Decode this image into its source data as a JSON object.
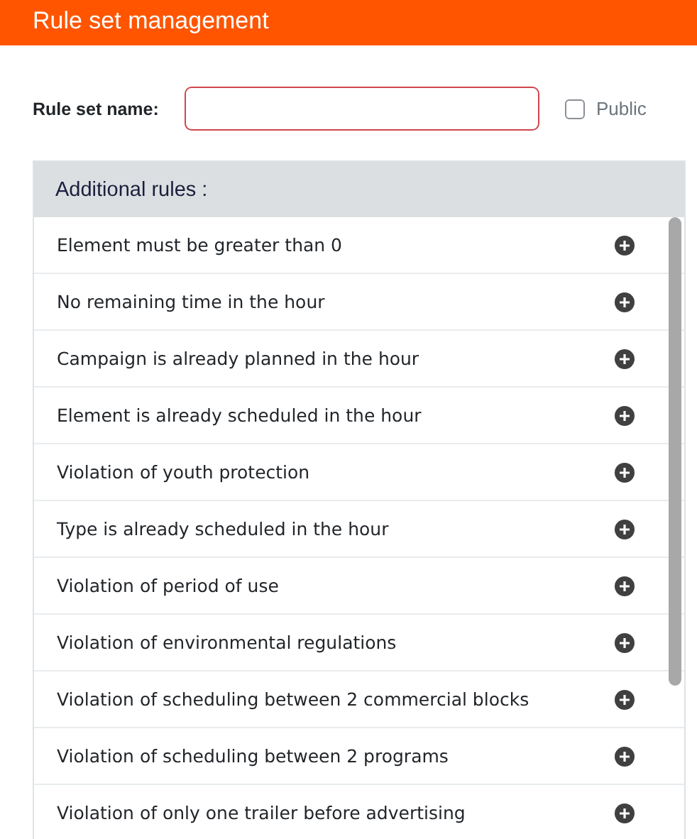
{
  "window": {
    "title": "Rule set management"
  },
  "form": {
    "name_label": "Rule set name:",
    "public": {
      "label": "Public",
      "checked": false
    }
  },
  "rules_panel": {
    "title": "Additional rules :",
    "rules": [
      {
        "label": "Element must be greater than 0"
      },
      {
        "label": "No remaining time in the hour"
      },
      {
        "label": "Campaign is already planned in the hour"
      },
      {
        "label": "Element is already scheduled in the hour"
      },
      {
        "label": "Violation of youth protection"
      },
      {
        "label": "Type is already scheduled in the hour"
      },
      {
        "label": "Violation of period of use"
      },
      {
        "label": "Violation of environmental regulations"
      },
      {
        "label": "Violation of scheduling between 2 commercial blocks"
      },
      {
        "label": "Violation of scheduling between 2 programs"
      },
      {
        "label": "Violation of only one trailer before advertising"
      }
    ]
  }
}
